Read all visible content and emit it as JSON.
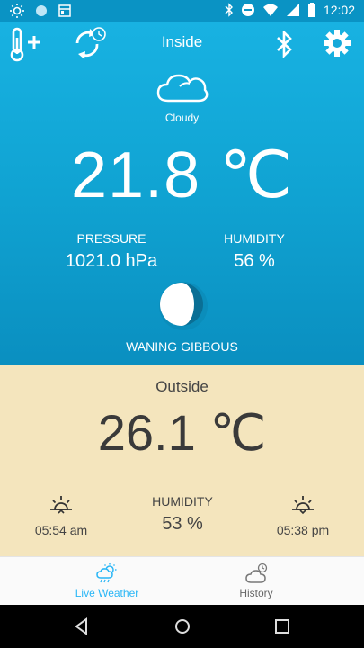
{
  "status_bar": {
    "time": "12:02",
    "icons_left": [
      "brightness-icon",
      "circle-icon",
      "calendar-icon"
    ],
    "icons_right": [
      "bluetooth-icon",
      "do-not-disturb-icon",
      "wifi-icon",
      "signal-icon",
      "battery-icon"
    ]
  },
  "header": {
    "title": "Inside"
  },
  "inside": {
    "condition": "Cloudy",
    "temperature": "21.8 ℃",
    "pressure_label": "PRESSURE",
    "pressure_value": "1021.0 hPa",
    "humidity_label": "HUMIDITY",
    "humidity_value": "56 %",
    "moon_phase": "WANING GIBBOUS"
  },
  "outside": {
    "title": "Outside",
    "temperature": "26.1 ℃",
    "sunrise": "05:54 am",
    "humidity_label": "HUMIDITY",
    "humidity_value": "53 %",
    "sunset": "05:38 pm"
  },
  "bottom_nav": {
    "items": [
      {
        "label": "Live Weather",
        "active": true
      },
      {
        "label": "History",
        "active": false
      }
    ]
  },
  "colors": {
    "accent": "#29b6f6",
    "inside_bg": "#10a3d2",
    "outside_bg": "#f4e5bd"
  }
}
